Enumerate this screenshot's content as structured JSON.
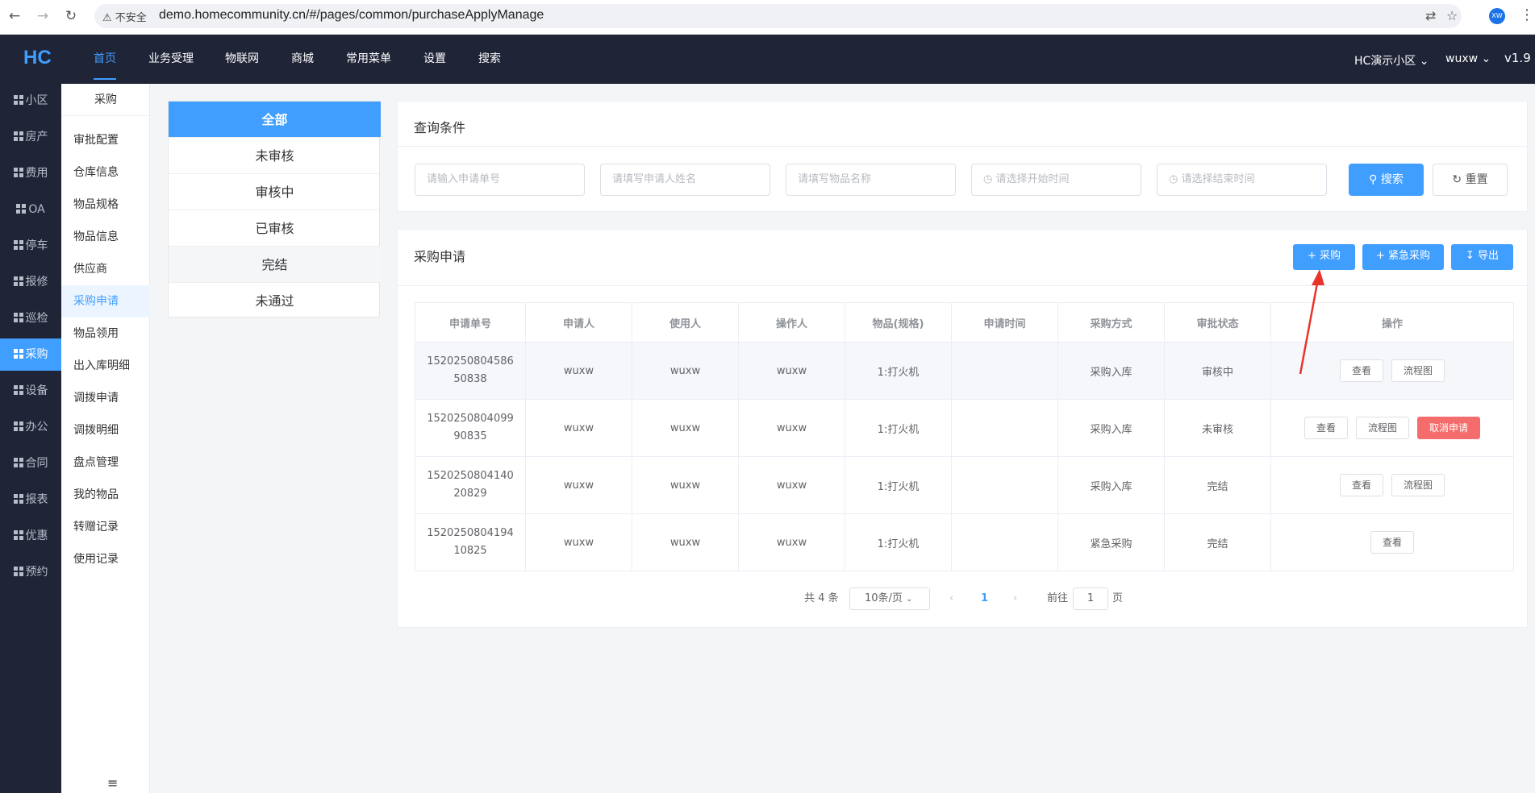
{
  "browser": {
    "insecure_label": "不安全",
    "url": "demo.homecommunity.cn/#/pages/common/purchaseApplyManage",
    "profile_initials": "XW"
  },
  "topnav": {
    "logo": "HC",
    "items": [
      "首页",
      "业务受理",
      "物联网",
      "商城",
      "常用菜单",
      "设置",
      "搜索"
    ],
    "community": "HC演示小区",
    "user": "wuxw",
    "version": "v1.9"
  },
  "sidebar1": [
    "小区",
    "房产",
    "费用",
    "OA",
    "停车",
    "报修",
    "巡检",
    "采购",
    "设备",
    "办公",
    "合同",
    "报表",
    "优惠",
    "预约"
  ],
  "sidebar2": {
    "header": "采购",
    "items": [
      "审批配置",
      "仓库信息",
      "物品规格",
      "物品信息",
      "供应商",
      "采购申请",
      "物品领用",
      "出入库明细",
      "调拨申请",
      "调拨明细",
      "盘点管理",
      "我的物品",
      "转赠记录",
      "使用记录"
    ]
  },
  "status_tabs": [
    "全部",
    "未审核",
    "审核中",
    "已审核",
    "完结",
    "未通过"
  ],
  "query": {
    "title": "查询条件",
    "placeholders": [
      "请输入申请单号",
      "请填写申请人姓名",
      "请填写物品名称",
      "请选择开始时间",
      "请选择结束时间"
    ],
    "search_label": "搜索",
    "reset_label": "重置"
  },
  "table_card": {
    "title": "采购申请",
    "btn_purchase": "采购",
    "btn_urgent": "紧急采购",
    "btn_export": "导出",
    "columns": [
      "申请单号",
      "申请人",
      "使用人",
      "操作人",
      "物品(规格)",
      "申请时间",
      "采购方式",
      "审批状态",
      "操作"
    ],
    "rows": [
      {
        "id": "152025080458650838",
        "applicant": "wuxw",
        "user": "wuxw",
        "operator": "wuxw",
        "item": "1:打火机",
        "time": "",
        "method": "采购入库",
        "status": "审核中",
        "actions": [
          "查看",
          "流程图"
        ]
      },
      {
        "id": "152025080409990835",
        "applicant": "wuxw",
        "user": "wuxw",
        "operator": "wuxw",
        "item": "1:打火机",
        "time": "",
        "method": "采购入库",
        "status": "未审核",
        "actions": [
          "查看",
          "流程图",
          "取消申请"
        ]
      },
      {
        "id": "152025080414020829",
        "applicant": "wuxw",
        "user": "wuxw",
        "operator": "wuxw",
        "item": "1:打火机",
        "time": "",
        "method": "采购入库",
        "status": "完结",
        "actions": [
          "查看",
          "流程图"
        ]
      },
      {
        "id": "152025080419410825",
        "applicant": "wuxw",
        "user": "wuxw",
        "operator": "wuxw",
        "item": "1:打火机",
        "time": "",
        "method": "紧急采购",
        "status": "完结",
        "actions": [
          "查看"
        ]
      }
    ]
  },
  "pagination": {
    "total": "共 4 条",
    "page_size": "10条/页",
    "current_page": "1",
    "goto_label": "前往",
    "goto_value": "1",
    "page_suffix": "页"
  },
  "colors": {
    "primary": "#409eff",
    "danger": "#f56c6c",
    "nav_bg": "#1f2437",
    "annotation": "#e8342a"
  }
}
